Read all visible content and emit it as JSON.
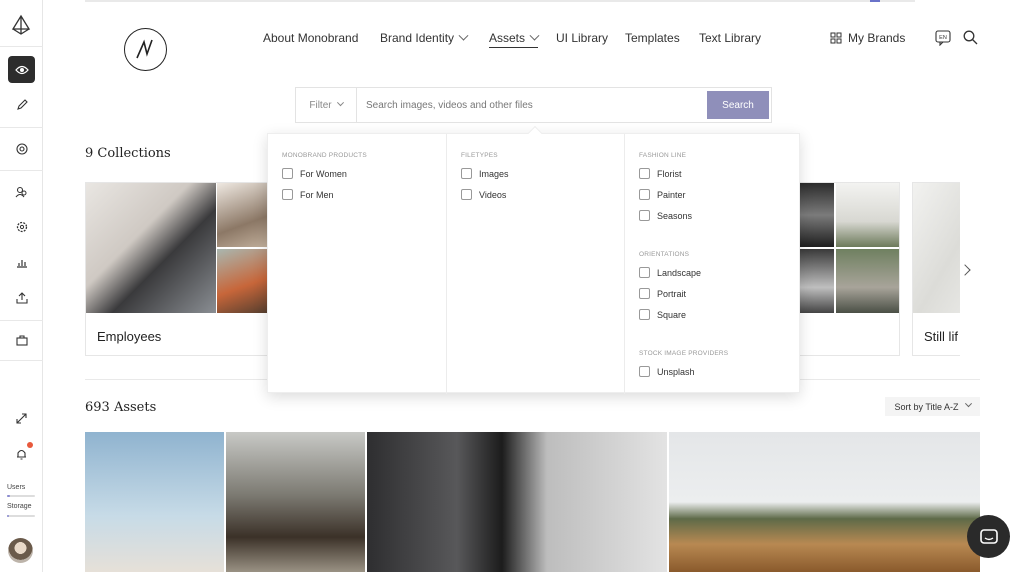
{
  "nav": {
    "items": [
      {
        "label": "About Monobrand"
      },
      {
        "label": "Brand Identity"
      },
      {
        "label": "Assets"
      },
      {
        "label": "UI Library"
      },
      {
        "label": "Templates"
      },
      {
        "label": "Text Library"
      }
    ],
    "my_brands": "My Brands",
    "lang_badge": "EN"
  },
  "search": {
    "filter_label": "Filter",
    "placeholder": "Search images, videos and other files",
    "button": "Search"
  },
  "collections": {
    "heading": "9 Collections",
    "items": [
      {
        "title": "Employees"
      },
      {
        "title": "Still lif"
      }
    ]
  },
  "filter_panel": {
    "groups": [
      {
        "title": "MONOBRAND PRODUCTS",
        "options": [
          "For Women",
          "For Men"
        ]
      },
      {
        "title": "FILETYPES",
        "options": [
          "Images",
          "Videos"
        ]
      },
      {
        "title": "FASHION LINE",
        "options": [
          "Florist",
          "Painter",
          "Seasons"
        ]
      },
      {
        "title": "ORIENTATIONS",
        "options": [
          "Landscape",
          "Portrait",
          "Square"
        ]
      },
      {
        "title": "STOCK IMAGE PROVIDERS",
        "options": [
          "Unsplash"
        ]
      }
    ]
  },
  "assets": {
    "heading": "693 Assets",
    "sort_label": "Sort by Title A-Z"
  },
  "sidebar": {
    "usage": [
      {
        "label": "Users",
        "fraction": 0.1
      },
      {
        "label": "Storage",
        "fraction": 0.08
      }
    ]
  },
  "colors": {
    "accent": "#8f8fba",
    "rail_active": "#2d2d2d",
    "notification": "#e8593c"
  }
}
